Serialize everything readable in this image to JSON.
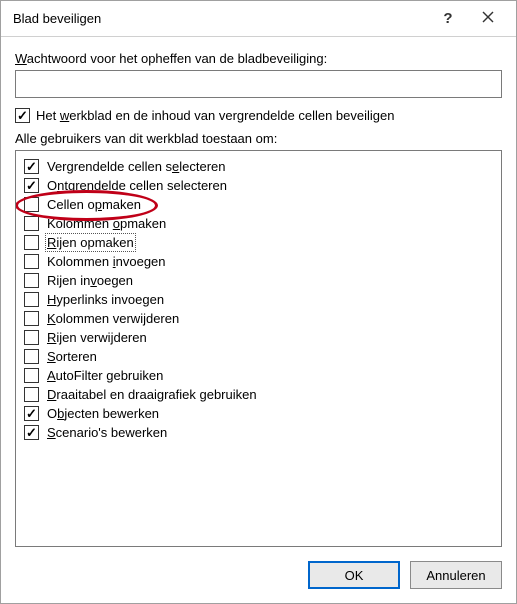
{
  "titlebar": {
    "title": "Blad beveiligen"
  },
  "password_label_pre": "W",
  "password_label_rest": "achtwoord voor het opheffen van de bladbeveiliging:",
  "password_value": "",
  "protect_checkbox": {
    "checked": true,
    "label_pre": "Het ",
    "label_ul": "w",
    "label_post": "erkblad en de inhoud van vergrendelde cellen beveiligen"
  },
  "list_label": "Alle gebruikers van dit werkblad toestaan om:",
  "permissions": [
    {
      "checked": true,
      "pre": "Vergrendelde cellen s",
      "ul": "e",
      "post": "lecteren",
      "focus": false
    },
    {
      "checked": true,
      "pre": "O",
      "ul": "n",
      "post": "tgrendelde cellen selecteren",
      "focus": false
    },
    {
      "checked": false,
      "pre": "Cellen o",
      "ul": "p",
      "post": "maken",
      "focus": false,
      "highlight": true
    },
    {
      "checked": false,
      "pre": "Kolommen ",
      "ul": "o",
      "post": "pmaken",
      "focus": false
    },
    {
      "checked": false,
      "pre": "",
      "ul": "R",
      "post": "ijen opmaken",
      "focus": true
    },
    {
      "checked": false,
      "pre": "Kolommen ",
      "ul": "i",
      "post": "nvoegen",
      "focus": false
    },
    {
      "checked": false,
      "pre": "Rijen in",
      "ul": "v",
      "post": "oegen",
      "focus": false
    },
    {
      "checked": false,
      "pre": "",
      "ul": "H",
      "post": "yperlinks invoegen",
      "focus": false
    },
    {
      "checked": false,
      "pre": "",
      "ul": "K",
      "post": "olommen verwijderen",
      "focus": false
    },
    {
      "checked": false,
      "pre": "",
      "ul": "R",
      "post": "ijen verwijderen",
      "focus": false
    },
    {
      "checked": false,
      "pre": "",
      "ul": "S",
      "post": "orteren",
      "focus": false
    },
    {
      "checked": false,
      "pre": "",
      "ul": "A",
      "post": "utoFilter gebruiken",
      "focus": false
    },
    {
      "checked": false,
      "pre": "",
      "ul": "D",
      "post": "raaitabel en draaigrafiek gebruiken",
      "focus": false
    },
    {
      "checked": true,
      "pre": "O",
      "ul": "b",
      "post": "jecten bewerken",
      "focus": false
    },
    {
      "checked": true,
      "pre": "",
      "ul": "S",
      "post": "cenario's bewerken",
      "focus": false
    }
  ],
  "buttons": {
    "ok": "OK",
    "cancel": "Annuleren"
  }
}
